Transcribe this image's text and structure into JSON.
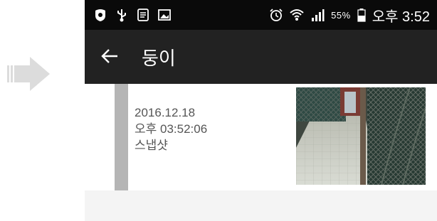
{
  "status_bar": {
    "battery_percent": "55%",
    "time": "오후 3:52",
    "left_icons": [
      "shield-icon",
      "usb-icon",
      "notes-icon",
      "gallery-icon"
    ],
    "right_icons": [
      "alarm-icon",
      "wifi-icon",
      "signal-icon",
      "battery-icon"
    ]
  },
  "app_bar": {
    "title": "둥이"
  },
  "event": {
    "date": "2016.12.18",
    "time": "오후 03:52:06",
    "type": "스냅샷"
  },
  "colors": {
    "status_bar_bg": "#0a0a0a",
    "app_bar_bg": "#222222",
    "rail": "#b5b5b5",
    "arrow": "#dcdcdc"
  }
}
